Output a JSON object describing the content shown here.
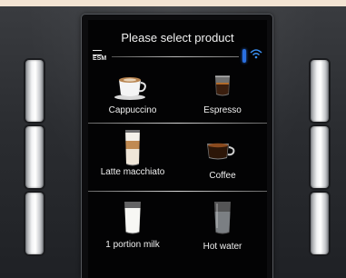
{
  "screen": {
    "title": "Please select product",
    "logo_text": "ESM"
  },
  "products": [
    {
      "label": "Cappuccino",
      "icon": "cappuccino-cup-icon"
    },
    {
      "label": "Espresso",
      "icon": "espresso-glass-icon"
    },
    {
      "label": "Latte macchiato",
      "icon": "latte-macchiato-glass-icon"
    },
    {
      "label": "Coffee",
      "icon": "coffee-cup-icon"
    },
    {
      "label": "1 portion milk",
      "icon": "milk-glass-icon"
    },
    {
      "label": "Hot water",
      "icon": "hot-water-glass-icon"
    }
  ],
  "colors": {
    "accent_blue": "#2a6fe0",
    "top_strip": "#f3e4d3",
    "panel": "#2b2d31"
  },
  "side_buttons": {
    "left_count": 3,
    "right_count": 3
  }
}
